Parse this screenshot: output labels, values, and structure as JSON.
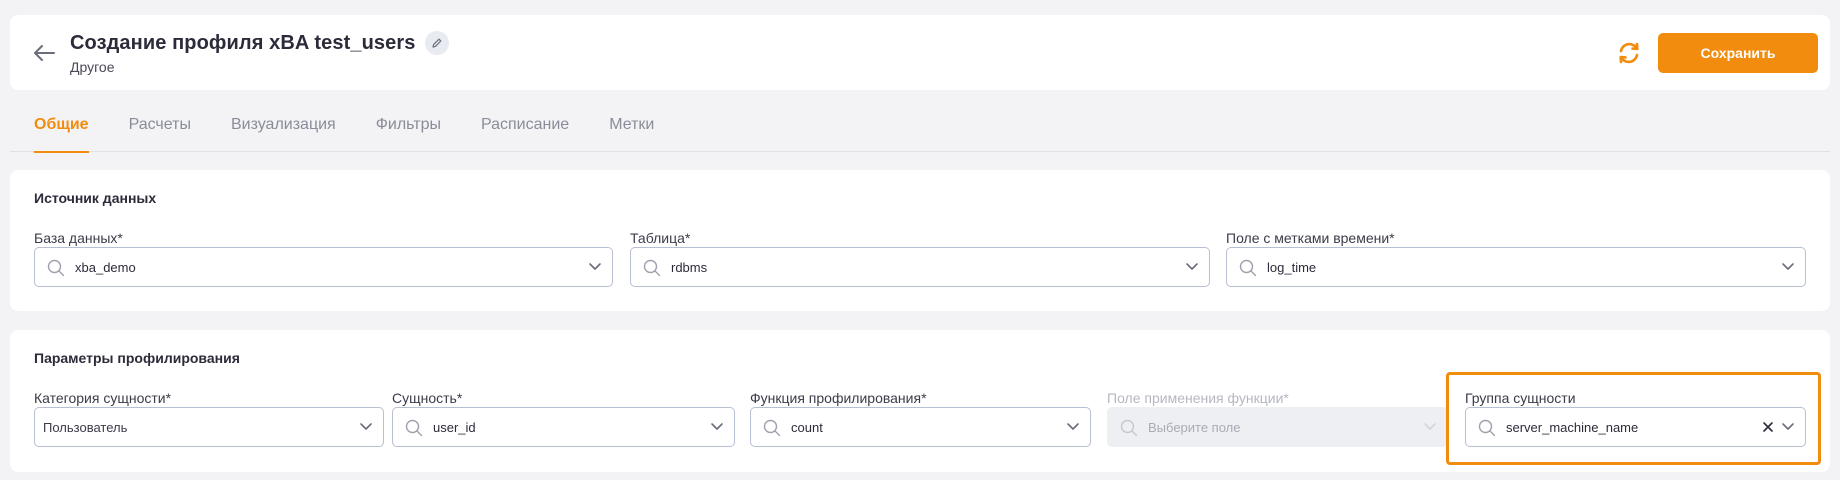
{
  "header": {
    "title": "Создание профиля xBA test_users",
    "subtitle": "Другое",
    "save_label": "Сохранить"
  },
  "tabs": [
    {
      "label": "Общие",
      "active": true
    },
    {
      "label": "Расчеты",
      "active": false
    },
    {
      "label": "Визуализация",
      "active": false
    },
    {
      "label": "Фильтры",
      "active": false
    },
    {
      "label": "Расписание",
      "active": false
    },
    {
      "label": "Метки",
      "active": false
    }
  ],
  "datasource": {
    "title": "Источник данных",
    "database": {
      "label": "База данных*",
      "value": "xba_demo"
    },
    "table": {
      "label": "Таблица*",
      "value": "rdbms"
    },
    "time_field": {
      "label": "Поле с метками времени*",
      "value": "log_time"
    }
  },
  "profiling": {
    "title": "Параметры профилирования",
    "entity_category": {
      "label": "Категория сущности*",
      "value": "Пользователь"
    },
    "entity": {
      "label": "Сущность*",
      "value": "user_id"
    },
    "function": {
      "label": "Функция профилирования*",
      "value": "count"
    },
    "function_field": {
      "label": "Поле применения функции*",
      "placeholder": "Выберите поле",
      "disabled": true
    },
    "entity_group": {
      "label": "Группа сущности",
      "value": "server_machine_name"
    }
  },
  "colors": {
    "accent": "#f28c0f",
    "border": "#b8bfd2",
    "background": "#f3f3f6"
  }
}
